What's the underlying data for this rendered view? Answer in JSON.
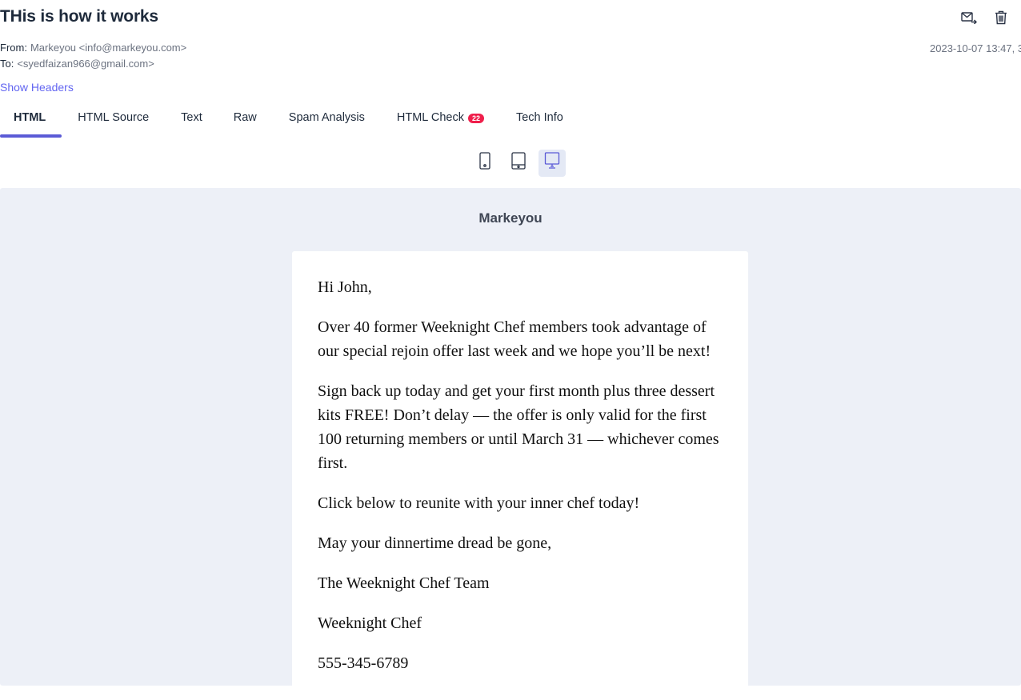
{
  "email": {
    "subject": "THis is how it works",
    "from_label": "From:",
    "from_value": "Markeyou <info@markeyou.com>",
    "to_label": "To:",
    "to_value": "<syedfaizan966@gmail.com>",
    "date": "2023-10-07 13:47, 3",
    "show_headers": "Show Headers"
  },
  "actions": {
    "forward_icon": "forward-mail-icon",
    "delete_icon": "trash-icon"
  },
  "tabs": [
    {
      "label": "HTML",
      "active": true
    },
    {
      "label": "HTML Source"
    },
    {
      "label": "Text"
    },
    {
      "label": "Raw"
    },
    {
      "label": "Spam Analysis"
    },
    {
      "label": "HTML Check",
      "badge": "22"
    },
    {
      "label": "Tech Info"
    }
  ],
  "devices": [
    {
      "name": "mobile",
      "icon": "phone-icon"
    },
    {
      "name": "tablet",
      "icon": "tablet-icon"
    },
    {
      "name": "desktop",
      "icon": "desktop-icon",
      "active": true
    }
  ],
  "preview": {
    "brand": "Markeyou",
    "paragraphs": [
      "Hi John,",
      "Over 40 former Weeknight Chef members took advantage of our special rejoin offer last week and we hope you’ll be next!",
      "Sign back up today and get your first month plus three dessert kits FREE! Don’t delay — the offer is only valid for the first 100 returning members or until March 31 — whichever comes first.",
      "Click below to reunite with your inner chef today!",
      "May your dinnertime dread be gone,",
      "The Weeknight Chef Team",
      "Weeknight Chef",
      "555-345-6789"
    ]
  },
  "colors": {
    "accent": "#5b5bd6",
    "link": "#6366f1",
    "badge": "#ef1f4b",
    "preview_bg": "#edf0f7"
  }
}
